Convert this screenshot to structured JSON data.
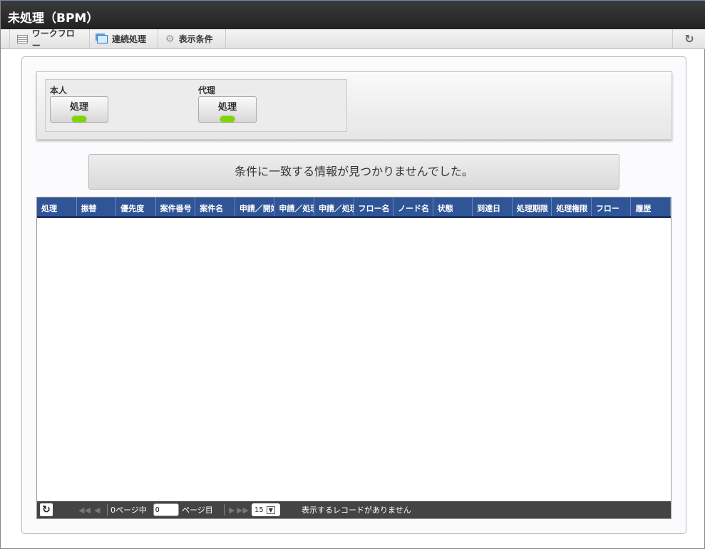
{
  "title": "未処理（BPM）",
  "toolbar": {
    "workflow": "ワークフロー",
    "continuous": "連続処理",
    "display_conditions": "表示条件"
  },
  "panel": {
    "self_label": "本人",
    "self_button": "処理",
    "proxy_label": "代理",
    "proxy_button": "処理"
  },
  "message": "条件に一致する情報が見つかりませんでした。",
  "columns": [
    "処理",
    "振替",
    "優先度",
    "案件番号",
    "案件名",
    "申請／開始",
    "申請／処理",
    "申請／処理",
    "フロー名",
    "ノード名",
    "状態",
    "到達日",
    "処理期限",
    "処理権限",
    "フロー",
    "履歴"
  ],
  "pager": {
    "total_pages": "0",
    "of_pages": "ページ中",
    "page_value": "0",
    "page_suffix": "ページ目",
    "page_size": "15",
    "status": "表示するレコードがありません"
  }
}
